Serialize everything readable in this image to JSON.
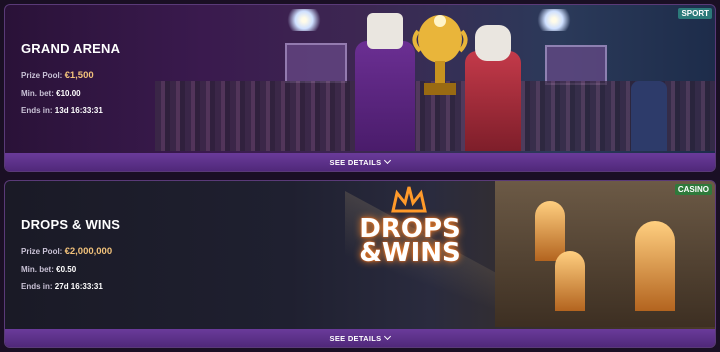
{
  "promotions": [
    {
      "title": "GRAND ARENA",
      "badge": "SPORT",
      "prize_label": "Prize Pool:",
      "prize_value": "€1,500",
      "minbet_label": "Min. bet:",
      "minbet_value": "€10.00",
      "ends_label": "Ends in:",
      "ends_value": "13d 16:33:31",
      "details_label": "SEE DETAILS"
    },
    {
      "title": "DROPS & WINS",
      "badge": "CASINO",
      "prize_label": "Prize Pool:",
      "prize_value": "€2,000,000",
      "minbet_label": "Min. bet:",
      "minbet_value": "€0.50",
      "ends_label": "Ends in:",
      "ends_value": "27d 16:33:31",
      "details_label": "SEE DETAILS",
      "logo_line1": "DROPS",
      "logo_line2": "&WINS"
    }
  ],
  "colors": {
    "accent_gold": "#f2c27b",
    "details_bar": "#5f3390",
    "sport_badge": "#2c7a7a",
    "casino_badge": "#2f7a3b"
  }
}
